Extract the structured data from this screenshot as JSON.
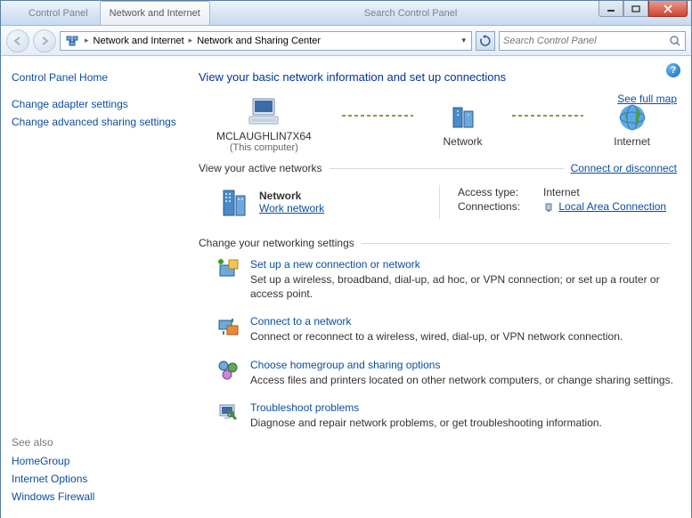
{
  "titlebar": {
    "tabs": [
      {
        "label": "Control Panel"
      },
      {
        "label": "Network and Internet"
      },
      {
        "label": "Search Control Panel"
      }
    ]
  },
  "address": {
    "seg1": "Network and Internet",
    "seg2": "Network and Sharing Center"
  },
  "search": {
    "placeholder": "Search Control Panel"
  },
  "sidebar": {
    "home": "Control Panel Home",
    "links": [
      "Change adapter settings",
      "Change advanced sharing settings"
    ],
    "seealso_label": "See also",
    "seealso": [
      "HomeGroup",
      "Internet Options",
      "Windows Firewall"
    ]
  },
  "main": {
    "heading": "View your basic network information and set up connections",
    "full_map": "See full map",
    "nodes": {
      "computer": "MCLAUGHLIN7X64",
      "computer_sub": "(This computer)",
      "network": "Network",
      "internet": "Internet"
    },
    "active_label": "View your active networks",
    "connect_link": "Connect or disconnect",
    "active": {
      "name": "Network",
      "type": "Work network",
      "access_key": "Access type:",
      "access_val": "Internet",
      "conn_key": "Connections:",
      "conn_val": "Local Area Connection"
    },
    "change_label": "Change your networking settings",
    "settings": [
      {
        "title": "Set up a new connection or network",
        "desc": "Set up a wireless, broadband, dial-up, ad hoc, or VPN connection; or set up a router or access point."
      },
      {
        "title": "Connect to a network",
        "desc": "Connect or reconnect to a wireless, wired, dial-up, or VPN network connection."
      },
      {
        "title": "Choose homegroup and sharing options",
        "desc": "Access files and printers located on other network computers, or change sharing settings."
      },
      {
        "title": "Troubleshoot problems",
        "desc": "Diagnose and repair network problems, or get troubleshooting information."
      }
    ]
  }
}
